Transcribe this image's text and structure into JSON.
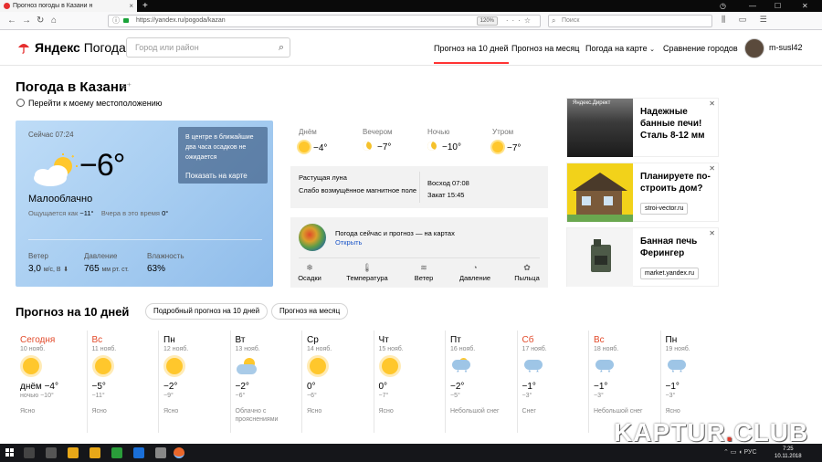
{
  "browser": {
    "tab_title": "Прогноз погоды в Казани н",
    "url": "https://yandex.ru/pogoda/kazan",
    "zoom": "120%",
    "search_placeholder": "Поиск"
  },
  "header": {
    "logo_brand": "Яндекс",
    "logo_product": "Погода",
    "search_placeholder": "Город или район",
    "nav": [
      {
        "label": "Прогноз на 10 дней"
      },
      {
        "label": "Прогноз на месяц"
      },
      {
        "label": "Погода на карте"
      },
      {
        "label": "Сравнение городов"
      }
    ],
    "user_name": "m-susl42"
  },
  "page": {
    "title": "Погода в Казани",
    "geo_link": "Перейти к моему местоположению"
  },
  "current": {
    "time": "Сейчас 07:24",
    "temp": "−6°",
    "condition": "Малооблачно",
    "feels_label": "Ощущается как",
    "feels_value": "−11°",
    "yesterday_label": "Вчера в это время",
    "yesterday_value": "0°",
    "alert_text": "В центре в ближайшие два часа осадков не ожидается",
    "alert_link": "Показать на карте",
    "wind_label": "Ветер",
    "wind_value": "3,0",
    "wind_unit": "м/с, В",
    "pressure_label": "Давление",
    "pressure_value": "765",
    "pressure_unit": "мм рт. ст.",
    "humidity_label": "Влажность",
    "humidity_value": "63%"
  },
  "day_parts": [
    {
      "name": "Днём",
      "temp": "−4°",
      "icon": "sun-icon"
    },
    {
      "name": "Вечером",
      "temp": "−7°",
      "icon": "moon-icon"
    },
    {
      "name": "Ночью",
      "temp": "−10°",
      "icon": "moon-icon"
    },
    {
      "name": "Утром",
      "temp": "−7°",
      "icon": "sun-icon"
    }
  ],
  "astro": {
    "moon": "Растущая луна",
    "magnetic": "Слабо возмущённое магнитное поле",
    "sunrise": "Восход 07:08",
    "sunset": "Закат 15:45"
  },
  "maps": {
    "title": "Погода сейчас и прогноз — на картах",
    "open": "Открыть",
    "tabs": [
      {
        "label": "Осадки",
        "icon": "precipitation-icon"
      },
      {
        "label": "Температура",
        "icon": "thermometer-icon"
      },
      {
        "label": "Ветер",
        "icon": "wind-icon"
      },
      {
        "label": "Давление",
        "icon": "pressure-icon"
      },
      {
        "label": "Пыльца",
        "icon": "pollen-icon"
      }
    ]
  },
  "ads": [
    {
      "label": "Яндекс.Директ",
      "title": "Надежные банные печи! Сталь 8-12 мм",
      "button": "",
      "color": "#3b3b3b"
    },
    {
      "label": "",
      "title": "Планируете по-строить дом?",
      "button": "stroi-vector.ru",
      "color": "#f2d21a"
    },
    {
      "label": "",
      "title": "Банная печь Ферингер",
      "button": "market.yandex.ru",
      "color": "#f4f4f4"
    }
  ],
  "forecast": {
    "title": "Прогноз на 10 дней",
    "detailed_btn": "Подробный прогноз на 10 дней",
    "month_btn": "Прогноз на месяц",
    "days": [
      {
        "name": "Сегодня",
        "date": "10 нояб.",
        "hi": "днём −4°",
        "lo": "ночью −10°",
        "cond": "Ясно",
        "icon": "sun",
        "red": true
      },
      {
        "name": "Вс",
        "date": "11 нояб.",
        "hi": "−5°",
        "lo": "−11°",
        "cond": "Ясно",
        "icon": "sun",
        "red": true
      },
      {
        "name": "Пн",
        "date": "12 нояб.",
        "hi": "−2°",
        "lo": "−9°",
        "cond": "Ясно",
        "icon": "sun",
        "red": false
      },
      {
        "name": "Вт",
        "date": "13 нояб.",
        "hi": "−2°",
        "lo": "−6°",
        "cond": "Облачно с прояснениями",
        "icon": "cloudsun",
        "red": false
      },
      {
        "name": "Ср",
        "date": "14 нояб.",
        "hi": "0°",
        "lo": "−6°",
        "cond": "Ясно",
        "icon": "sun",
        "red": false
      },
      {
        "name": "Чт",
        "date": "15 нояб.",
        "hi": "0°",
        "lo": "−7°",
        "cond": "Ясно",
        "icon": "sun",
        "red": false
      },
      {
        "name": "Пт",
        "date": "16 нояб.",
        "hi": "−2°",
        "lo": "−5°",
        "cond": "Небольшой снег",
        "icon": "snowsun",
        "red": false
      },
      {
        "name": "Сб",
        "date": "17 нояб.",
        "hi": "−1°",
        "lo": "−3°",
        "cond": "Снег",
        "icon": "snow",
        "red": true
      },
      {
        "name": "Вс",
        "date": "18 нояб.",
        "hi": "−1°",
        "lo": "−3°",
        "cond": "Небольшой снег",
        "icon": "snow",
        "red": true
      },
      {
        "name": "Пн",
        "date": "19 нояб.",
        "hi": "−1°",
        "lo": "−3°",
        "cond": "Ясно",
        "icon": "snow",
        "red": false
      }
    ]
  },
  "watermark": {
    "text": "KAPTUR",
    "dot": ".",
    "tail": "CLUB"
  },
  "taskbar": {
    "lang": "РУС",
    "time": "7:25",
    "date": "10.11.2018"
  }
}
